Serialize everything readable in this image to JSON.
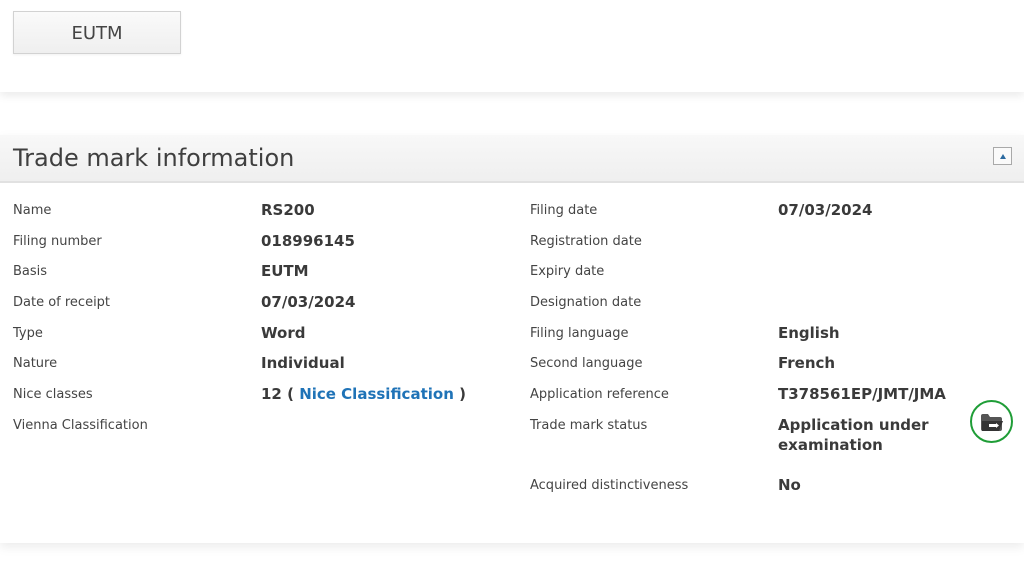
{
  "tab_button": {
    "label": "EUTM"
  },
  "panel": {
    "title": "Trade mark information",
    "collapse_icon": "chevron-up-icon"
  },
  "left_fields": [
    {
      "label": "Name",
      "value": "RS200"
    },
    {
      "label": "Filing number",
      "value": "018996145"
    },
    {
      "label": "Basis",
      "value": "EUTM"
    },
    {
      "label": "Date of receipt",
      "value": "07/03/2024"
    },
    {
      "label": "Type",
      "value": "Word"
    },
    {
      "label": "Nature",
      "value": "Individual"
    },
    {
      "label": "Nice classes",
      "value_prefix": "12 (",
      "link": "Nice Classification",
      "value_suffix": ")"
    },
    {
      "label": "Vienna Classification",
      "value": ""
    }
  ],
  "right_fields": [
    {
      "label": "Filing date",
      "value": "07/03/2024"
    },
    {
      "label": "Registration date",
      "value": ""
    },
    {
      "label": "Expiry date",
      "value": ""
    },
    {
      "label": "Designation date",
      "value": ""
    },
    {
      "label": "Filing language",
      "value": "English"
    },
    {
      "label": "Second language",
      "value": "French"
    },
    {
      "label": "Application reference",
      "value": "T378561EP/JMT/JMA"
    },
    {
      "label": "Trade mark status",
      "value": "Application under examination"
    },
    {
      "label": "Acquired distinctiveness",
      "value": "No"
    }
  ],
  "status_action": {
    "icon": "folder-icon",
    "border_color": "#1f9d37"
  },
  "colors": {
    "link": "#1f73b7",
    "text": "#3a3a3a"
  }
}
